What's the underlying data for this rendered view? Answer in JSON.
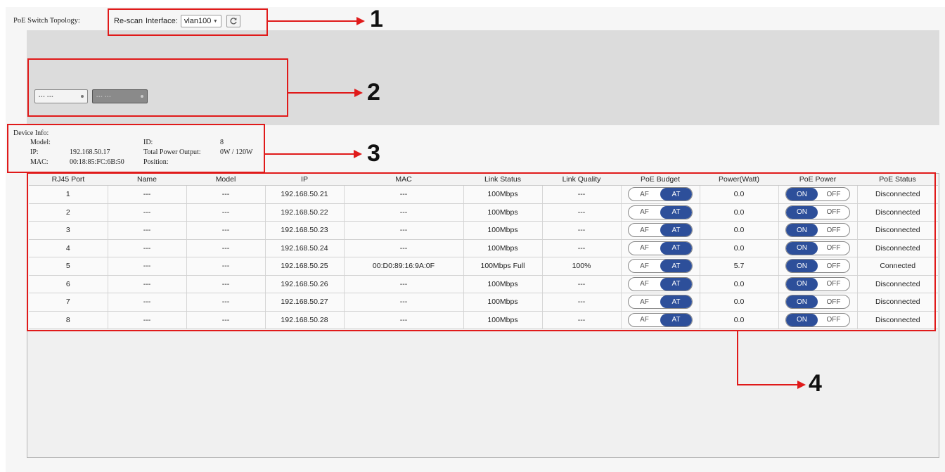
{
  "topology": {
    "label": "PoE Switch Topology:",
    "rescan_label": "Re-scan",
    "interface_label": "Interface:",
    "interface_value": "vlan100"
  },
  "device_info": {
    "title": "Device Info:",
    "model_label": "Model:",
    "model_value": "",
    "ip_label": "IP:",
    "ip_value": "192.168.50.17",
    "mac_label": "MAC:",
    "mac_value": "00:18:85:FC:6B:50",
    "id_label": "ID:",
    "id_value": "8",
    "power_label": "Total Power Output:",
    "power_value": "0W / 120W",
    "position_label": "Position:",
    "position_value": ""
  },
  "table": {
    "headers": [
      "RJ45 Port",
      "Name",
      "Model",
      "IP",
      "MAC",
      "Link Status",
      "Link Quality",
      "PoE Budget",
      "Power(Watt)",
      "PoE Power",
      "PoE Status"
    ],
    "budget_options": [
      "AF",
      "AT"
    ],
    "power_options": [
      "ON",
      "OFF"
    ],
    "rows": [
      {
        "port": "1",
        "name": "---",
        "model": "---",
        "ip": "192.168.50.21",
        "mac": "---",
        "link": "100Mbps",
        "quality": "---",
        "budget": "AT",
        "watt": "0.0",
        "power": "ON",
        "status": "Disconnected"
      },
      {
        "port": "2",
        "name": "---",
        "model": "---",
        "ip": "192.168.50.22",
        "mac": "---",
        "link": "100Mbps",
        "quality": "---",
        "budget": "AT",
        "watt": "0.0",
        "power": "ON",
        "status": "Disconnected"
      },
      {
        "port": "3",
        "name": "---",
        "model": "---",
        "ip": "192.168.50.23",
        "mac": "---",
        "link": "100Mbps",
        "quality": "---",
        "budget": "AT",
        "watt": "0.0",
        "power": "ON",
        "status": "Disconnected"
      },
      {
        "port": "4",
        "name": "---",
        "model": "---",
        "ip": "192.168.50.24",
        "mac": "---",
        "link": "100Mbps",
        "quality": "---",
        "budget": "AT",
        "watt": "0.0",
        "power": "ON",
        "status": "Disconnected"
      },
      {
        "port": "5",
        "name": "---",
        "model": "---",
        "ip": "192.168.50.25",
        "mac": "00:D0:89:16:9A:0F",
        "link": "100Mbps Full",
        "quality": "100%",
        "budget": "AT",
        "watt": "5.7",
        "power": "ON",
        "status": "Connected"
      },
      {
        "port": "6",
        "name": "---",
        "model": "---",
        "ip": "192.168.50.26",
        "mac": "---",
        "link": "100Mbps",
        "quality": "---",
        "budget": "AT",
        "watt": "0.0",
        "power": "ON",
        "status": "Disconnected"
      },
      {
        "port": "7",
        "name": "---",
        "model": "---",
        "ip": "192.168.50.27",
        "mac": "---",
        "link": "100Mbps",
        "quality": "---",
        "budget": "AT",
        "watt": "0.0",
        "power": "ON",
        "status": "Disconnected"
      },
      {
        "port": "8",
        "name": "---",
        "model": "---",
        "ip": "192.168.50.28",
        "mac": "---",
        "link": "100Mbps",
        "quality": "---",
        "budget": "AT",
        "watt": "0.0",
        "power": "ON",
        "status": "Disconnected"
      }
    ]
  },
  "callouts": [
    "1",
    "2",
    "3",
    "4"
  ],
  "colors": {
    "highlight": "#e01a1a",
    "toggle_active": "#2d4f9a",
    "topology_bg": "#dcdcdc"
  }
}
